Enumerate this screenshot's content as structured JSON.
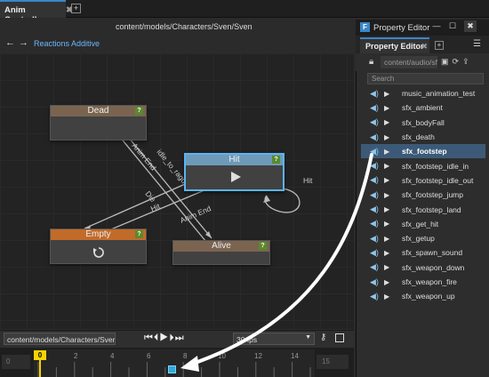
{
  "anim_editor": {
    "tab_title": "Anim Controller",
    "tab_close": "✖",
    "tab_add": "+",
    "path": "content/models/Characters/Sven/Sven",
    "nav_back": "←",
    "nav_forward": "→",
    "breadcrumb": "Reactions Additive"
  },
  "graph": {
    "nodes": {
      "dead": {
        "label": "Dead",
        "badge": "?"
      },
      "hit": {
        "label": "Hit",
        "badge": "?"
      },
      "empty": {
        "label": "Empty",
        "badge": "?"
      },
      "alive": {
        "label": "Alive",
        "badge": "?"
      }
    },
    "transitions": {
      "anim_end_1": "Anim End",
      "idle": "idle_to_ragdoll",
      "hit": "Hit",
      "die": "Die",
      "anim_end_2": "Anim End",
      "hit_self": "Hit"
    }
  },
  "timeline": {
    "path": "content/models/Characters/Sven/",
    "controls": "⏮⏴▶⏵⏭",
    "fps": "30 fps",
    "start_frame": "0",
    "end_frame": "15",
    "playhead": "0",
    "ticks": [
      "2",
      "4",
      "6",
      "8",
      "10",
      "12",
      "14"
    ]
  },
  "property_editor": {
    "window_title": "Property Editor",
    "tab_label": "Property Editor",
    "path": "content/audio/sfx",
    "search_placeholder": "Search",
    "items": [
      "music_animation_test",
      "sfx_ambient",
      "sfx_bodyFall",
      "sfx_death",
      "sfx_footstep",
      "sfx_footstep_idle_in",
      "sfx_footstep_idle_out",
      "sfx_footstep_jump",
      "sfx_footstep_land",
      "sfx_get_hit",
      "sfx_getup",
      "sfx_spawn_sound",
      "sfx_weapon_down",
      "sfx_weapon_fire",
      "sfx_weapon_up"
    ],
    "selected": "sfx_footstep"
  },
  "colors": {
    "accent": "#3a86c8",
    "selection": "#3c5a78",
    "hit_node_border": "#5ab4f0",
    "playhead": "#f5d400",
    "empty_node_header": "#c26a2a"
  },
  "icons": {
    "speaker": "speaker-icon",
    "play": "play-icon",
    "lock": "lock-icon",
    "loop": "loop-icon"
  }
}
